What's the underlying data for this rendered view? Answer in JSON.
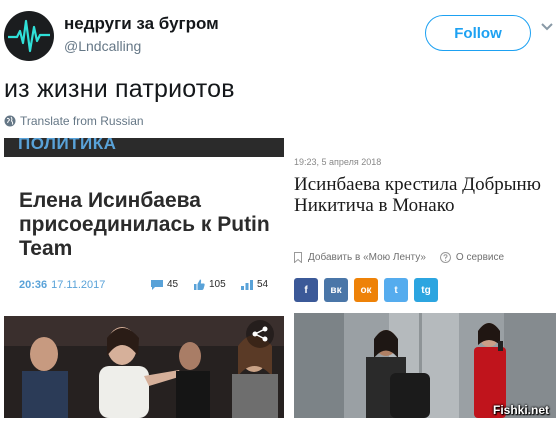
{
  "tweet": {
    "author_name": "недруги за бугром",
    "author_handle": "@Lndcalling",
    "follow_label": "Follow",
    "text": "из жизни патриотов",
    "translate_label": "Translate from Russian"
  },
  "left_article": {
    "section": "ПОЛИТИКА",
    "title": "Елена Исинбаева присоединилась к Putin Team",
    "time": "20:36",
    "date": "17.11.2017",
    "comments": "45",
    "likes": "105",
    "shares": "54"
  },
  "right_article": {
    "meta": "19:23, 5 апреля 2018",
    "title": "Исинбаева крестила Добрыню Никитича в Монако",
    "bookmark_label": "Добавить в «Мою Ленту»",
    "about_label": "О сервисе",
    "social_labels": [
      "f",
      "вк",
      "ок",
      "t",
      "tg"
    ]
  },
  "watermark": "Fishki.net",
  "colors": {
    "twitter_blue": "#1da1f2",
    "section_blue": "#59a2d8",
    "facebook": "#3b5998",
    "vk": "#4a76a8",
    "ok": "#ee8208",
    "twitter": "#55acee",
    "telegram": "#2ca5e0"
  }
}
